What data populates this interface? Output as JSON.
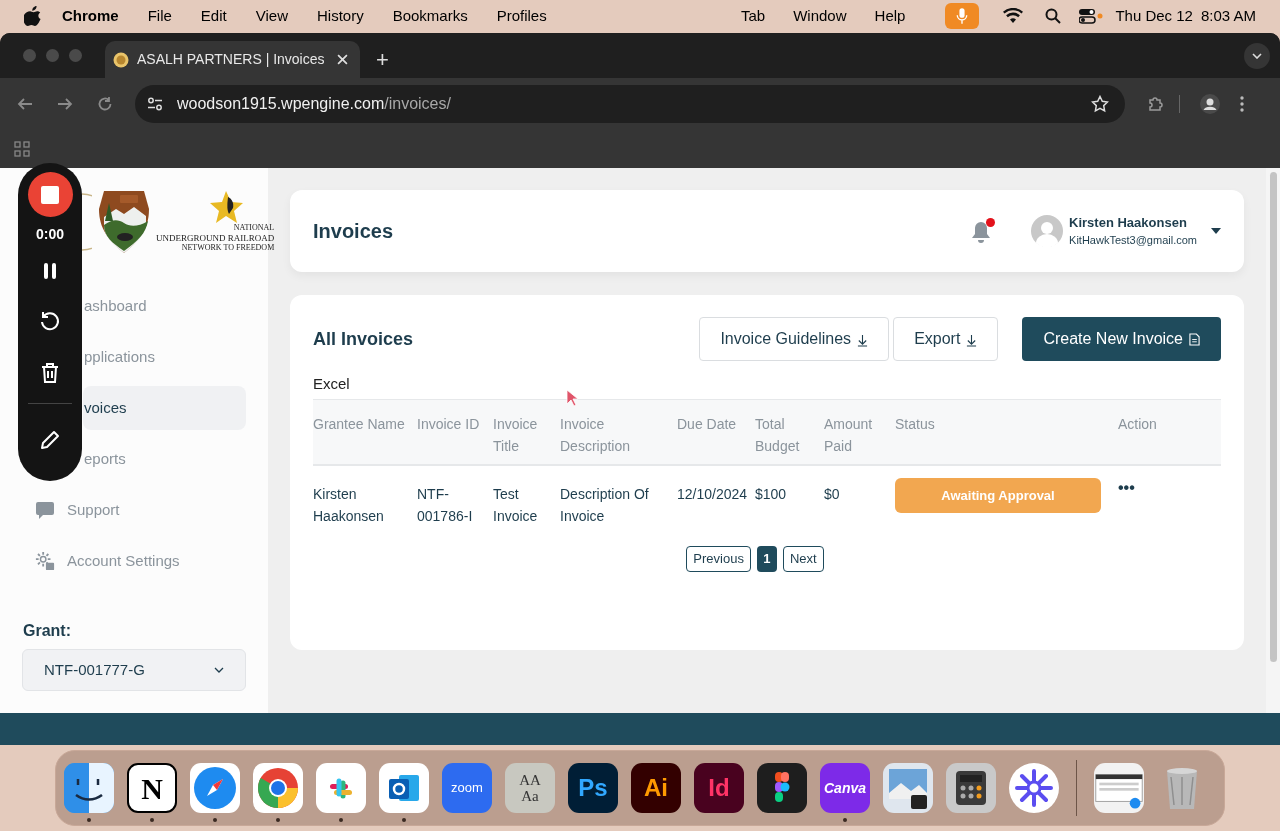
{
  "menu_bar": {
    "app": "Chrome",
    "menus": [
      "File",
      "Edit",
      "View",
      "History",
      "Bookmarks",
      "Profiles"
    ],
    "right_menus": [
      "Tab",
      "Window",
      "Help"
    ],
    "mic_active": true,
    "date": "Thu Dec 12",
    "time": "8:03 AM"
  },
  "browser": {
    "tabs": [
      {
        "title": "ASALH PARTNERS | Invoices",
        "selected": true
      }
    ],
    "new_tab": "+",
    "url_host": "woodson1915.wpengine.com",
    "url_path": "/invoices/"
  },
  "recorder": {
    "timer": "0:00"
  },
  "sidebar": {
    "logo_text": [
      "NATIONAL",
      "UNDERGROUND RAILROAD",
      "NETWORK TO FREEDOM"
    ],
    "nav": [
      {
        "label": "ashboard",
        "kind": "covered",
        "selected": false
      },
      {
        "label": "pplications",
        "kind": "covered",
        "selected": false
      },
      {
        "label": "voices",
        "kind": "covered",
        "selected": true
      },
      {
        "label": "eports",
        "kind": "covered",
        "selected": false
      },
      {
        "label": "Support",
        "kind": "support",
        "selected": false
      },
      {
        "label": "Account Settings",
        "kind": "settings",
        "selected": false
      }
    ],
    "grant_label": "Grant:",
    "grant_value": "NTF-001777-G"
  },
  "header": {
    "title": "Invoices",
    "unread_notifications": true,
    "user_name": "Kirsten Haakonsen",
    "user_email": "KitHawkTest3@gmail.com"
  },
  "invoices": {
    "title": "All Invoices",
    "buttons": [
      {
        "label": "Invoice Guidelines",
        "kind": "outline"
      },
      {
        "label": "Export",
        "kind": "outline"
      },
      {
        "label": "Create New Invoice",
        "kind": "primary"
      }
    ],
    "export_format": "Excel",
    "table": {
      "columns": [
        "Grantee Name",
        "Invoice ID",
        "Invoice Title",
        "Invoice Description",
        "Due Date",
        "Total Budget",
        "Amount Paid",
        "Status",
        "Action"
      ],
      "rows": [
        {
          "cells": [
            "Kirsten Haakonsen",
            "NTF-001786-I",
            "Test Invoice",
            "Description Of Invoice",
            "12/10/2024",
            "$100",
            "$0"
          ],
          "status": "Awaiting Approval",
          "action": "•••"
        }
      ]
    },
    "pagination": {
      "previous": "Previous",
      "pages": [
        {
          "label": "1",
          "selected": true
        }
      ],
      "next": "Next"
    }
  },
  "dock": [
    {
      "kind": "finder",
      "running": true
    },
    {
      "kind": "notion",
      "glyph": "N",
      "running": true
    },
    {
      "kind": "safari",
      "running": true
    },
    {
      "kind": "chrome",
      "running": true
    },
    {
      "kind": "slack",
      "running": true
    },
    {
      "kind": "outlook",
      "running": true
    },
    {
      "kind": "zoom",
      "glyph": "zoom",
      "running": false
    },
    {
      "kind": "fontbook",
      "glyph": "AA Aa",
      "running": false
    },
    {
      "kind": "photoshop",
      "glyph": "Ps",
      "running": false
    },
    {
      "kind": "illustrator",
      "glyph": "Ai",
      "running": false
    },
    {
      "kind": "indesign",
      "glyph": "Id",
      "running": false
    },
    {
      "kind": "figma",
      "running": false
    },
    {
      "kind": "canva",
      "glyph": "Canva",
      "running": true
    },
    {
      "kind": "preview",
      "running": false
    },
    {
      "kind": "calculator",
      "running": false
    },
    {
      "kind": "asterisk",
      "running": false
    },
    {
      "kind": "separator"
    },
    {
      "kind": "window",
      "running": false
    },
    {
      "kind": "trash",
      "running": false
    }
  ]
}
